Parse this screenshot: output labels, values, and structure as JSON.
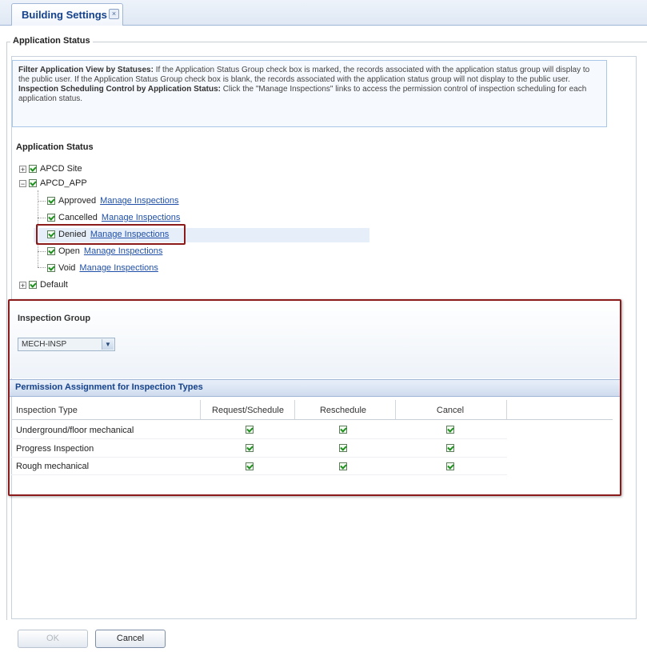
{
  "tab": {
    "label": "Building Settings",
    "close_glyph": "×"
  },
  "fieldset": {
    "legend": "Application Status"
  },
  "info": {
    "filter_bold": "Filter Application View by Statuses:",
    "filter_text": " If the Application Status Group check box is marked, the records associated with the application status group will display to the public user. If the Application Status Group check box is blank, the records associated with the application status group will not display to the public user.",
    "sched_bold": "Inspection Scheduling Control by Application Status:",
    "sched_text": " Click the \"Manage Inspections\" links to access the permission control of inspection scheduling for each application status."
  },
  "status_title": "Application Status",
  "tree": {
    "root1": {
      "label": "APCD Site",
      "expander": "+"
    },
    "root2": {
      "label": "APCD_APP",
      "expander": "−"
    },
    "children": [
      {
        "label": "Approved",
        "link": "Manage Inspections"
      },
      {
        "label": "Cancelled",
        "link": "Manage Inspections"
      },
      {
        "label": "Denied",
        "link": "Manage Inspections"
      },
      {
        "label": "Open",
        "link": "Manage Inspections"
      },
      {
        "label": "Void",
        "link": "Manage Inspections"
      }
    ],
    "root3": {
      "label": "Default",
      "expander": "+"
    }
  },
  "inspection_group": {
    "label": "Inspection Group",
    "selected": "MECH-INSP",
    "dropdown_icon": "chevron-down-icon"
  },
  "permissions": {
    "title": "Permission Assignment for Inspection Types",
    "columns": [
      "Inspection Type",
      "Request/Schedule",
      "Reschedule",
      "Cancel"
    ],
    "rows": [
      {
        "type": "Underground/floor mechanical",
        "request": true,
        "reschedule": true,
        "cancel": true
      },
      {
        "type": "Progress Inspection",
        "request": true,
        "reschedule": true,
        "cancel": true
      },
      {
        "type": "Rough mechanical",
        "request": true,
        "reschedule": true,
        "cancel": true
      }
    ]
  },
  "buttons": {
    "ok": "OK",
    "cancel": "Cancel"
  },
  "colors": {
    "highlight_border": "#8b1a1a",
    "accent": "#15428b",
    "link": "#1f4fa8"
  }
}
